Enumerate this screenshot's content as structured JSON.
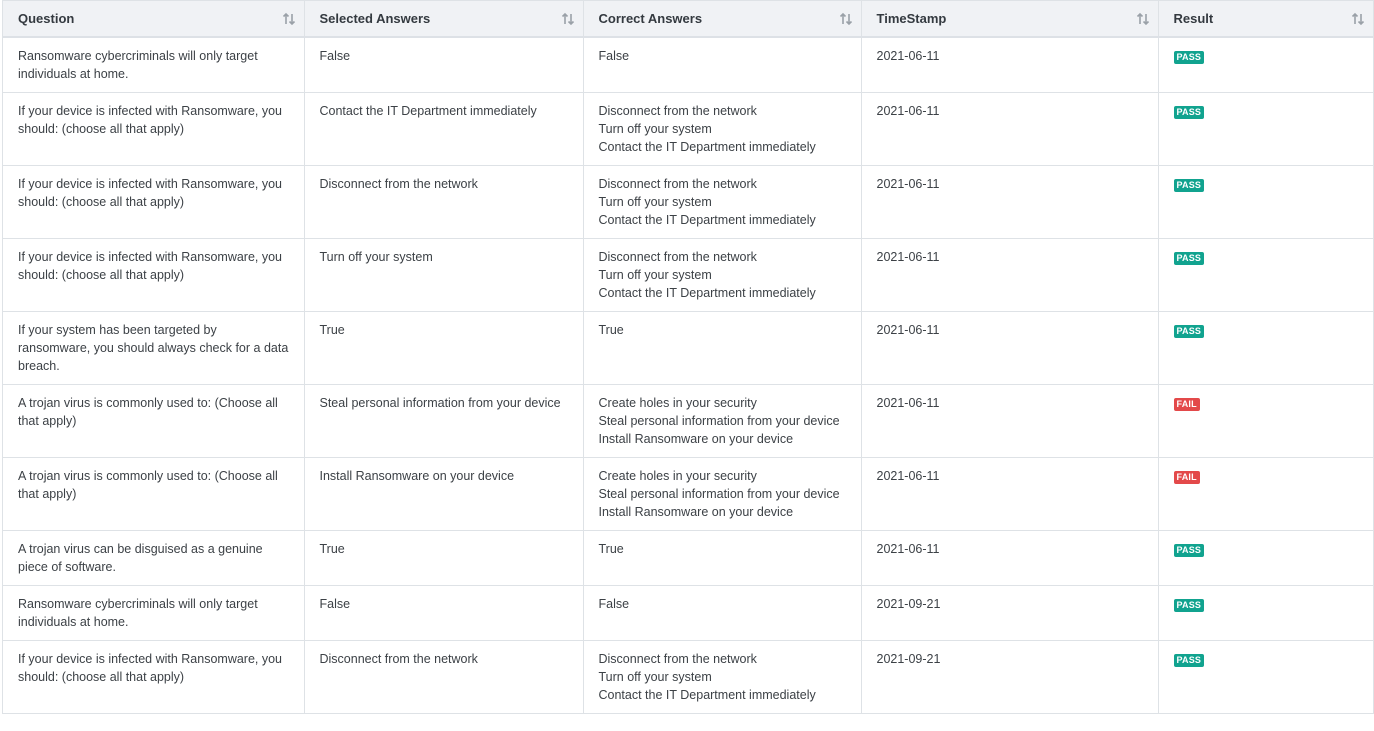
{
  "colors": {
    "header_bg": "#f0f2f5",
    "pass": "#11a38f",
    "fail": "#e3494a",
    "border": "#dee2e6"
  },
  "table": {
    "headers": [
      "Question",
      "Selected Answers",
      "Correct Answers",
      "TimeStamp",
      "Result"
    ],
    "sort_icon": "sort-arrows-icon",
    "rows": [
      {
        "question": "Ransomware cybercriminals will only target individuals at home.",
        "selected": "False",
        "correct": [
          "False"
        ],
        "timestamp": "2021-06-11",
        "result": "PASS"
      },
      {
        "question": "If your device is infected with Ransomware, you should: (choose all that apply)",
        "selected": "Contact the IT Department immediately",
        "correct": [
          "Disconnect from the network",
          "Turn off your system",
          "Contact the IT Department immediately"
        ],
        "timestamp": "2021-06-11",
        "result": "PASS"
      },
      {
        "question": "If your device is infected with Ransomware, you should: (choose all that apply)",
        "selected": "Disconnect from the network",
        "correct": [
          "Disconnect from the network",
          "Turn off your system",
          "Contact the IT Department immediately"
        ],
        "timestamp": "2021-06-11",
        "result": "PASS"
      },
      {
        "question": "If your device is infected with Ransomware, you should: (choose all that apply)",
        "selected": "Turn off your system",
        "correct": [
          "Disconnect from the network",
          "Turn off your system",
          "Contact the IT Department immediately"
        ],
        "timestamp": "2021-06-11",
        "result": "PASS"
      },
      {
        "question": "If your system has been targeted by ransomware, you should always check for a data breach.",
        "selected": "True",
        "correct": [
          "True"
        ],
        "timestamp": "2021-06-11",
        "result": "PASS"
      },
      {
        "question": "A trojan virus is commonly used to: (Choose all that apply)",
        "selected": "Steal personal information from your device",
        "correct": [
          "Create holes in your security",
          "Steal personal information from your device",
          "Install Ransomware on your device"
        ],
        "timestamp": "2021-06-11",
        "result": "FAIL"
      },
      {
        "question": "A trojan virus is commonly used to: (Choose all that apply)",
        "selected": "Install Ransomware on your device",
        "correct": [
          "Create holes in your security",
          "Steal personal information from your device",
          "Install Ransomware on your device"
        ],
        "timestamp": "2021-06-11",
        "result": "FAIL"
      },
      {
        "question": "A trojan virus can be disguised as a genuine piece of software.",
        "selected": "True",
        "correct": [
          "True"
        ],
        "timestamp": "2021-06-11",
        "result": "PASS"
      },
      {
        "question": "Ransomware cybercriminals will only target individuals at home.",
        "selected": "False",
        "correct": [
          "False"
        ],
        "timestamp": "2021-09-21",
        "result": "PASS"
      },
      {
        "question": "If your device is infected with Ransomware, you should: (choose all that apply)",
        "selected": "Disconnect from the network",
        "correct": [
          "Disconnect from the network",
          "Turn off your system",
          "Contact the IT Department immediately"
        ],
        "timestamp": "2021-09-21",
        "result": "PASS"
      }
    ]
  }
}
